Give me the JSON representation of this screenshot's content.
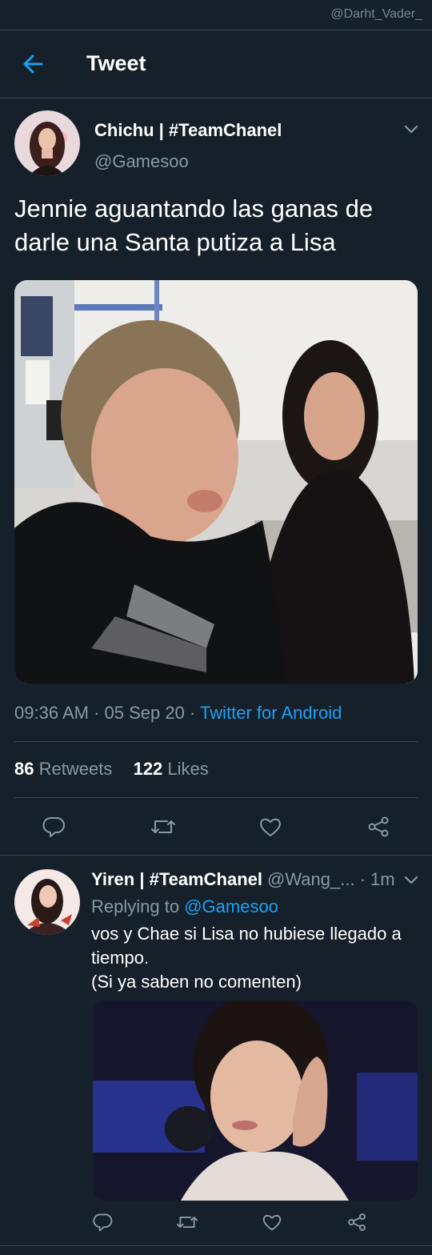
{
  "watermark": "@Darht_Vader_",
  "header": {
    "title": "Tweet"
  },
  "tweet": {
    "display_name": "Chichu | #TeamChanel",
    "handle": "@Gamesoo",
    "text": "Jennie aguantando las ganas de darle una Santa putiza a Lisa",
    "time": "09:36 AM",
    "date": "05 Sep 20",
    "source": "Twitter for Android",
    "retweets_count": "86",
    "retweets_label": "Retweets",
    "likes_count": "122",
    "likes_label": "Likes"
  },
  "reply": {
    "display_name": "Yiren | #TeamChanel",
    "handle": "@Wang_...",
    "time": "· 1m",
    "replying_to_label": "Replying to",
    "replying_to_handle": "@Gamesoo",
    "text": "vos y Chae si Lisa no hubiese llegado a tiempo.\n(Si ya saben no comenten)"
  },
  "icons": [
    "arrow-left",
    "chevron-down",
    "reply",
    "retweet",
    "like",
    "share"
  ],
  "colors": {
    "background": "#15202b",
    "accent": "#1da1f2",
    "muted": "#8899a6",
    "divider": "#38444d"
  }
}
